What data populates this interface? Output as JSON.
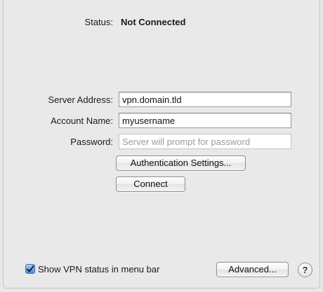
{
  "status": {
    "label": "Status:",
    "value": "Not Connected"
  },
  "form": {
    "server_address": {
      "label": "Server Address:",
      "value": "vpn.domain.tld"
    },
    "account_name": {
      "label": "Account Name:",
      "value": "myusername"
    },
    "password": {
      "label": "Password:",
      "placeholder": "Server will prompt for password"
    }
  },
  "buttons": {
    "auth_settings": "Authentication Settings...",
    "connect": "Connect",
    "advanced": "Advanced...",
    "help": "?"
  },
  "footer": {
    "show_status_label": "Show VPN status in menu bar",
    "show_status_checked": true
  },
  "icons": {
    "checkmark": "checkmark-icon",
    "help": "help-icon"
  },
  "colors": {
    "background": "#e8e8e8",
    "checkbox_accent": "#4d8be0"
  }
}
